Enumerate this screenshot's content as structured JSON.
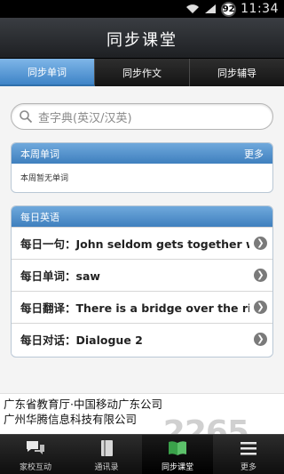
{
  "status_bar": {
    "battery": "92",
    "time": "11:34",
    "icons": [
      "wifi-icon",
      "signal-icon"
    ]
  },
  "header": {
    "title": "同步课堂"
  },
  "tabs": [
    {
      "label": "同步单词",
      "active": true
    },
    {
      "label": "同步作文",
      "active": false
    },
    {
      "label": "同步辅导",
      "active": false
    }
  ],
  "search": {
    "placeholder": "查字典(英汉/汉英)"
  },
  "weekly_words": {
    "title": "本周单词",
    "more": "更多",
    "empty_text": "本周暂无单词"
  },
  "daily_english": {
    "title": "每日英语",
    "items": [
      {
        "label": "每日一句：John seldom gets together wit..."
      },
      {
        "label": "每日单词：saw"
      },
      {
        "label": "每日翻译：There is a bridge over the river."
      },
      {
        "label": "每日对话：Dialogue 2"
      }
    ]
  },
  "footer": {
    "line1": "广东省教育厅·中国移动广东公司",
    "line2": "广州华腾信息科技有限公司"
  },
  "bottom_nav": [
    {
      "label": "家校互动",
      "icon": "chat-bubbles-icon",
      "active": false
    },
    {
      "label": "通讯录",
      "icon": "address-book-icon",
      "active": false
    },
    {
      "label": "同步课堂",
      "icon": "open-book-icon",
      "active": true
    },
    {
      "label": "更多",
      "icon": "menu-lines-icon",
      "active": false
    }
  ],
  "watermark": "2265",
  "colors": {
    "tab_active": "#4a8fd0",
    "panel_header": "#4f8dc9",
    "book_icon": "#3aa14a"
  }
}
